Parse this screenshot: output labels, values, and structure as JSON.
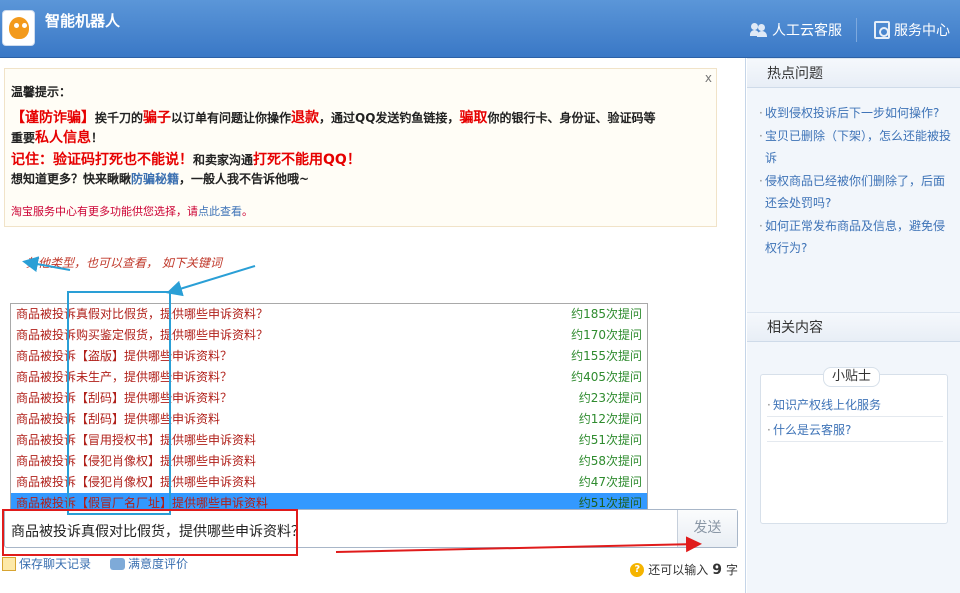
{
  "header": {
    "app_title": "智能机器人",
    "human_service_label": "人工云客服",
    "service_center_label": "服务中心"
  },
  "notice": {
    "close_label": "x",
    "heading": "温馨提示：",
    "line1_a": "【谨防诈骗】",
    "line1_b": "挨千刀的",
    "line1_c": "骗子",
    "line1_d": "以订单有问题让你操作",
    "line1_e": "退款",
    "line1_f": "，通过QQ发送钓鱼链接，",
    "line1_g": "骗取",
    "line1_h": "你的银行卡、身份证、验证码等",
    "line2_a": "重要",
    "line2_b": "私人信息",
    "line2_c": "！",
    "line3_a": "记住：验证码打死也不能说！",
    "line3_b": "和卖家沟通",
    "line3_c": "打死不能用QQ！",
    "line4_a": "想知道更多？快来瞅瞅",
    "line4_b": "防骗秘籍",
    "line4_c": "，一般人我不告诉他哦~",
    "footer_a": "淘宝服务中心有更多功能供您选择，请",
    "footer_link": "点此查看",
    "footer_b": "。"
  },
  "annotation": {
    "text": "其他类型，也可以查看，  如下关键词"
  },
  "suggestions": [
    {
      "query": "商品被投诉真假对比假货，提供哪些申诉资料？",
      "count": "约185次提问"
    },
    {
      "query": "商品被投诉购买鉴定假货，提供哪些申诉资料？",
      "count": "约170次提问"
    },
    {
      "query": "商品被投诉【盗版】提供哪些申诉资料？",
      "count": "约155次提问"
    },
    {
      "query": "商品被投诉未生产，提供哪些申诉资料？",
      "count": "约405次提问"
    },
    {
      "query": "商品被投诉【刮码】提供哪些申诉资料？",
      "count": "约23次提问"
    },
    {
      "query": "商品被投诉【刮码】提供哪些申诉资料",
      "count": "约12次提问"
    },
    {
      "query": "商品被投诉【冒用授权书】提供哪些申诉资料",
      "count": "约51次提问"
    },
    {
      "query": "商品被投诉【侵犯肖像权】提供哪些申诉资料",
      "count": "约58次提问"
    },
    {
      "query": "商品被投诉【侵犯肖像权】提供哪些申诉资料",
      "count": "约47次提问"
    },
    {
      "query": "商品被投诉【假冒厂名厂址】提供哪些申诉资料",
      "count": "约51次提问"
    }
  ],
  "input": {
    "value": "商品被投诉真假对比假货，提供哪些申诉资料？",
    "send_label": "发送"
  },
  "bottom": {
    "save_chat_label": "保存聊天记录",
    "rating_label": "满意度评价",
    "remain_prefix": "还可以输入",
    "remain_count": "9",
    "remain_suffix": "字"
  },
  "sidebar": {
    "hot_title": "热点问题",
    "hot_items": [
      "收到侵权投诉后下一步如何操作?",
      "宝贝已删除（下架），怎么还能被投诉",
      "侵权商品已经被你们删除了，后面还会处罚吗?",
      "如何正常发布商品及信息，避免侵权行为?"
    ],
    "related_title": "相关内容",
    "tips_title": "小贴士",
    "tips": [
      "知识产权线上化服务",
      "什么是云客服?"
    ]
  },
  "colors": {
    "header_blue": "#3a78c6",
    "warning_red": "#e60000",
    "selected_row": "#3399ff",
    "annotation_blue": "#2a9fd6",
    "annotation_red": "#e01b1b"
  }
}
